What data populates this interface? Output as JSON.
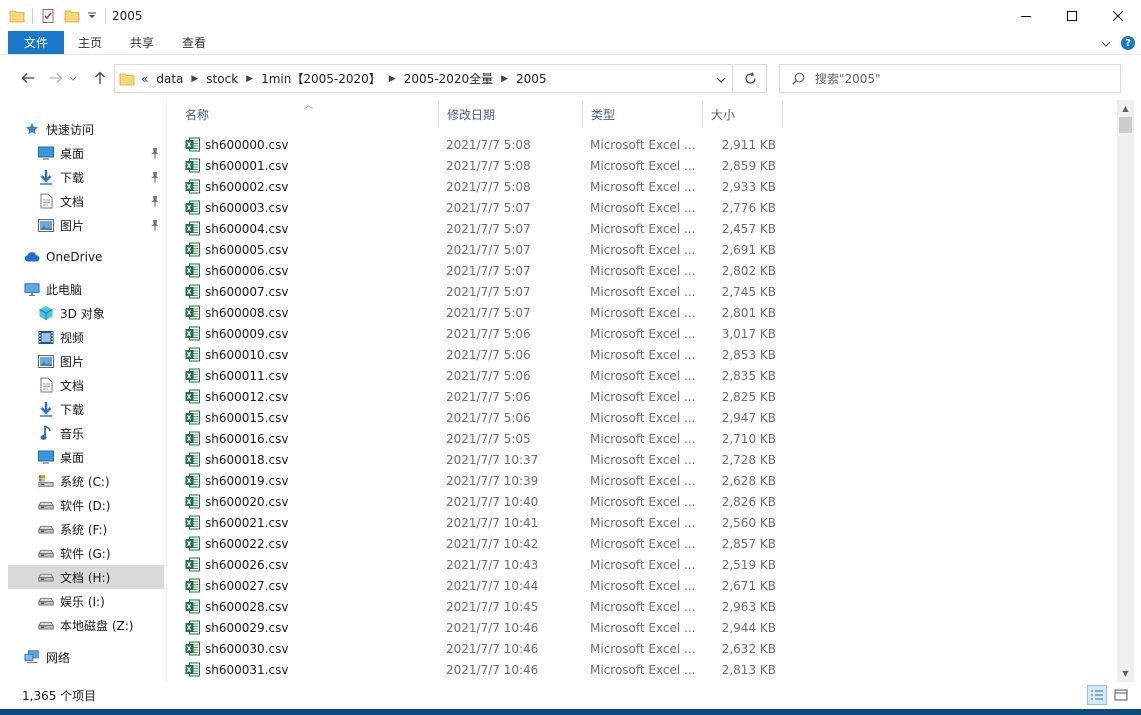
{
  "window": {
    "title": "2005"
  },
  "ribbon": {
    "tabs": [
      "文件",
      "主页",
      "共享",
      "查看"
    ]
  },
  "address": {
    "overflow": "«",
    "crumbs": [
      "data",
      "stock",
      "1min【2005-2020】",
      "2005-2020全量",
      "2005"
    ]
  },
  "search": {
    "placeholder": "搜索\"2005\""
  },
  "sidebar": {
    "items": [
      {
        "label": "快速访问",
        "icon": "star-icon",
        "pinned": false
      },
      {
        "label": "桌面",
        "icon": "desktop-icon",
        "pinned": true
      },
      {
        "label": "下载",
        "icon": "download-icon",
        "pinned": true
      },
      {
        "label": "文档",
        "icon": "document-icon",
        "pinned": true
      },
      {
        "label": "图片",
        "icon": "pictures-icon",
        "pinned": true
      },
      {
        "label": "OneDrive",
        "icon": "cloud-icon",
        "pinned": false
      },
      {
        "label": "此电脑",
        "icon": "computer-icon",
        "pinned": false
      },
      {
        "label": "3D 对象",
        "icon": "cube-icon",
        "pinned": false
      },
      {
        "label": "视频",
        "icon": "video-icon",
        "pinned": false
      },
      {
        "label": "图片",
        "icon": "pictures-icon",
        "pinned": false
      },
      {
        "label": "文档",
        "icon": "document-icon",
        "pinned": false
      },
      {
        "label": "下载",
        "icon": "download-icon",
        "pinned": false
      },
      {
        "label": "音乐",
        "icon": "music-icon",
        "pinned": false
      },
      {
        "label": "桌面",
        "icon": "desktop-icon",
        "pinned": false
      },
      {
        "label": "系统 (C:)",
        "icon": "system-drive-icon",
        "pinned": false
      },
      {
        "label": "软件 (D:)",
        "icon": "drive-icon",
        "pinned": false
      },
      {
        "label": "系统 (F:)",
        "icon": "drive-icon",
        "pinned": false
      },
      {
        "label": "软件 (G:)",
        "icon": "drive-icon",
        "pinned": false
      },
      {
        "label": "文档 (H:)",
        "icon": "drive-icon",
        "pinned": false,
        "selected": true
      },
      {
        "label": "娱乐 (I:)",
        "icon": "drive-icon",
        "pinned": false
      },
      {
        "label": "本地磁盘 (Z:)",
        "icon": "drive-icon",
        "pinned": false
      },
      {
        "label": "网络",
        "icon": "network-icon",
        "pinned": false
      }
    ]
  },
  "columns": {
    "name": "名称",
    "date": "修改日期",
    "type": "类型",
    "size": "大小"
  },
  "files": [
    {
      "name": "sh600000.csv",
      "date": "2021/7/7 5:08",
      "type": "Microsoft Excel ...",
      "size": "2,911 KB"
    },
    {
      "name": "sh600001.csv",
      "date": "2021/7/7 5:08",
      "type": "Microsoft Excel ...",
      "size": "2,859 KB"
    },
    {
      "name": "sh600002.csv",
      "date": "2021/7/7 5:08",
      "type": "Microsoft Excel ...",
      "size": "2,933 KB"
    },
    {
      "name": "sh600003.csv",
      "date": "2021/7/7 5:07",
      "type": "Microsoft Excel ...",
      "size": "2,776 KB"
    },
    {
      "name": "sh600004.csv",
      "date": "2021/7/7 5:07",
      "type": "Microsoft Excel ...",
      "size": "2,457 KB"
    },
    {
      "name": "sh600005.csv",
      "date": "2021/7/7 5:07",
      "type": "Microsoft Excel ...",
      "size": "2,691 KB"
    },
    {
      "name": "sh600006.csv",
      "date": "2021/7/7 5:07",
      "type": "Microsoft Excel ...",
      "size": "2,802 KB"
    },
    {
      "name": "sh600007.csv",
      "date": "2021/7/7 5:07",
      "type": "Microsoft Excel ...",
      "size": "2,745 KB"
    },
    {
      "name": "sh600008.csv",
      "date": "2021/7/7 5:07",
      "type": "Microsoft Excel ...",
      "size": "2,801 KB"
    },
    {
      "name": "sh600009.csv",
      "date": "2021/7/7 5:06",
      "type": "Microsoft Excel ...",
      "size": "3,017 KB"
    },
    {
      "name": "sh600010.csv",
      "date": "2021/7/7 5:06",
      "type": "Microsoft Excel ...",
      "size": "2,853 KB"
    },
    {
      "name": "sh600011.csv",
      "date": "2021/7/7 5:06",
      "type": "Microsoft Excel ...",
      "size": "2,835 KB"
    },
    {
      "name": "sh600012.csv",
      "date": "2021/7/7 5:06",
      "type": "Microsoft Excel ...",
      "size": "2,825 KB"
    },
    {
      "name": "sh600015.csv",
      "date": "2021/7/7 5:06",
      "type": "Microsoft Excel ...",
      "size": "2,947 KB"
    },
    {
      "name": "sh600016.csv",
      "date": "2021/7/7 5:05",
      "type": "Microsoft Excel ...",
      "size": "2,710 KB"
    },
    {
      "name": "sh600018.csv",
      "date": "2021/7/7 10:37",
      "type": "Microsoft Excel ...",
      "size": "2,728 KB"
    },
    {
      "name": "sh600019.csv",
      "date": "2021/7/7 10:39",
      "type": "Microsoft Excel ...",
      "size": "2,628 KB"
    },
    {
      "name": "sh600020.csv",
      "date": "2021/7/7 10:40",
      "type": "Microsoft Excel ...",
      "size": "2,826 KB"
    },
    {
      "name": "sh600021.csv",
      "date": "2021/7/7 10:41",
      "type": "Microsoft Excel ...",
      "size": "2,560 KB"
    },
    {
      "name": "sh600022.csv",
      "date": "2021/7/7 10:42",
      "type": "Microsoft Excel ...",
      "size": "2,857 KB"
    },
    {
      "name": "sh600026.csv",
      "date": "2021/7/7 10:43",
      "type": "Microsoft Excel ...",
      "size": "2,519 KB"
    },
    {
      "name": "sh600027.csv",
      "date": "2021/7/7 10:44",
      "type": "Microsoft Excel ...",
      "size": "2,671 KB"
    },
    {
      "name": "sh600028.csv",
      "date": "2021/7/7 10:45",
      "type": "Microsoft Excel ...",
      "size": "2,963 KB"
    },
    {
      "name": "sh600029.csv",
      "date": "2021/7/7 10:46",
      "type": "Microsoft Excel ...",
      "size": "2,944 KB"
    },
    {
      "name": "sh600030.csv",
      "date": "2021/7/7 10:46",
      "type": "Microsoft Excel ...",
      "size": "2,632 KB"
    },
    {
      "name": "sh600031.csv",
      "date": "2021/7/7 10:46",
      "type": "Microsoft Excel ...",
      "size": "2,813 KB"
    }
  ],
  "status": {
    "item_count": "1,365 个项目"
  },
  "colors": {
    "accent": "#1979ca",
    "excel_green": "#1e7145",
    "folder_yellow": "#f8d775",
    "selection_gray": "#d9d9d9",
    "header_text": "#4c607a",
    "meta_text": "#6d6d6d"
  }
}
